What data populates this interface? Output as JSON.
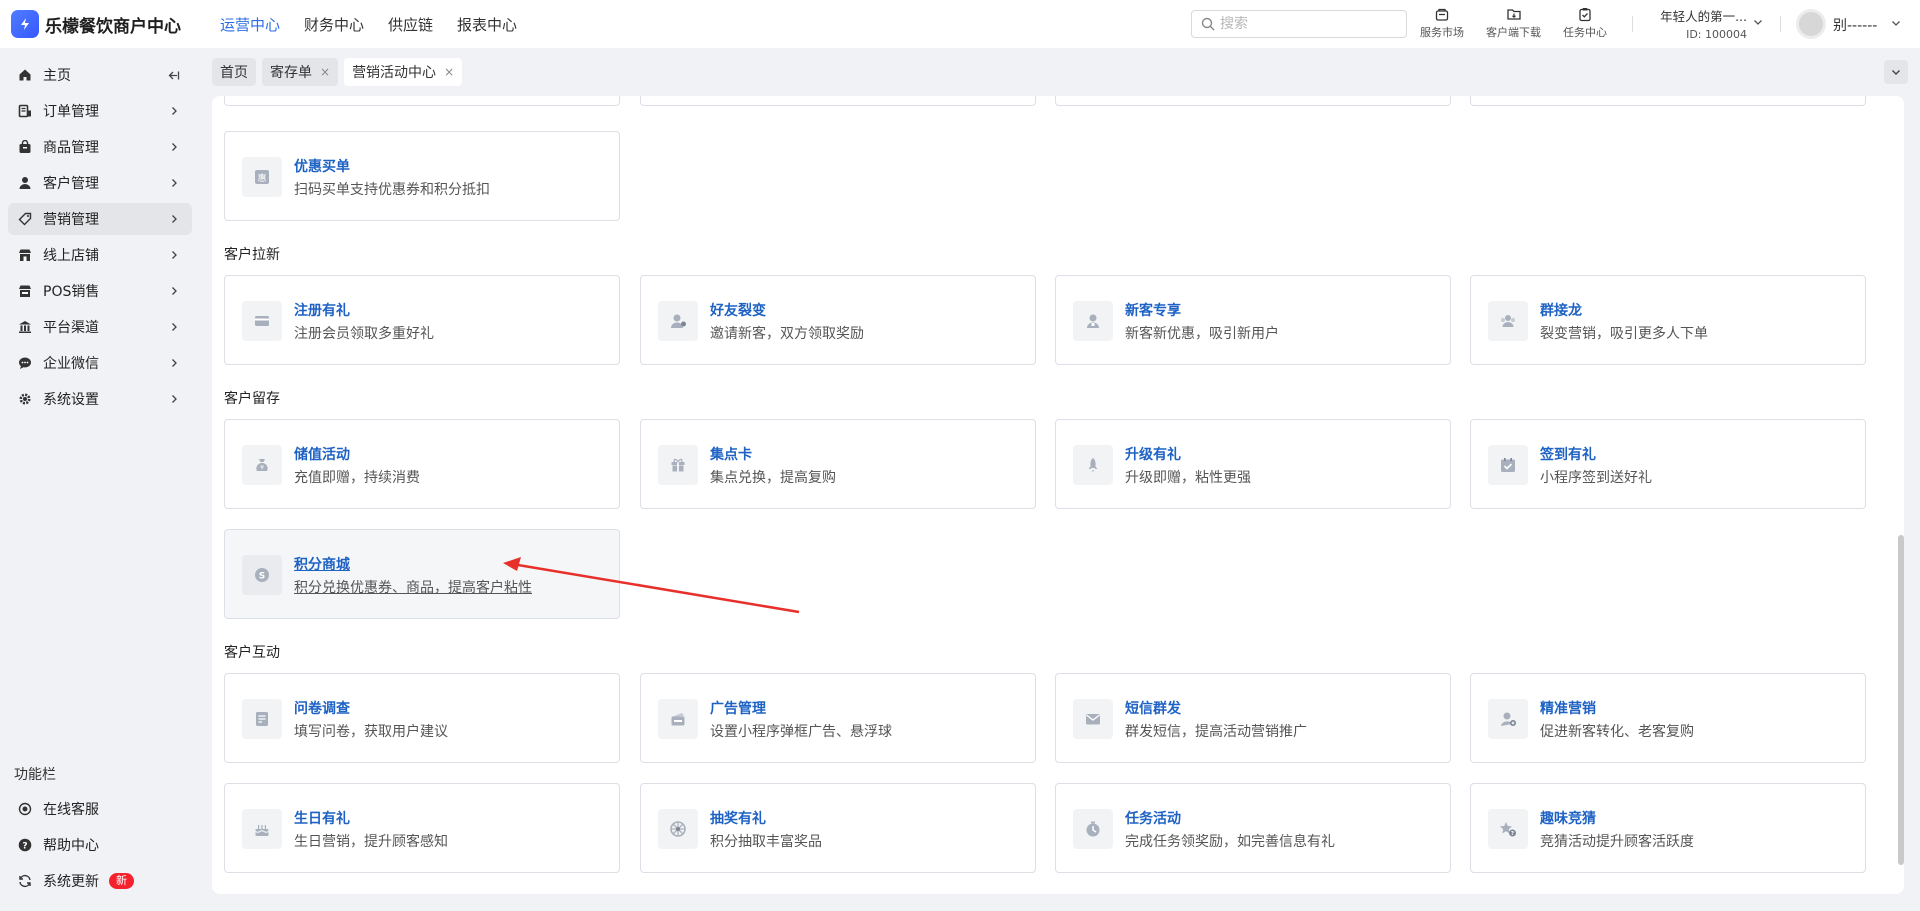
{
  "app": {
    "title": "乐檬餐饮商户中心"
  },
  "topnav": [
    "运营中心",
    "财务中心",
    "供应链",
    "报表中心"
  ],
  "search": {
    "placeholder": "搜索"
  },
  "tools": {
    "market": "服务市场",
    "download": "客户端下载",
    "tasks": "任务中心"
  },
  "account": {
    "name": "年轻人的第一...",
    "id": "ID: 100004",
    "user": "别------"
  },
  "sidebar": {
    "items": [
      {
        "label": "主页",
        "icon": "home-icon"
      },
      {
        "label": "订单管理",
        "icon": "order-icon"
      },
      {
        "label": "商品管理",
        "icon": "bag-icon"
      },
      {
        "label": "客户管理",
        "icon": "user-icon"
      },
      {
        "label": "营销管理",
        "icon": "tag-icon"
      },
      {
        "label": "线上店铺",
        "icon": "store-icon"
      },
      {
        "label": "POS销售",
        "icon": "pos-icon"
      },
      {
        "label": "平台渠道",
        "icon": "bank-icon"
      },
      {
        "label": "企业微信",
        "icon": "chat-icon"
      },
      {
        "label": "系统设置",
        "icon": "gear-icon"
      }
    ],
    "func_title": "功能栏",
    "bottom": [
      {
        "label": "在线客服",
        "icon": "support-icon"
      },
      {
        "label": "帮助中心",
        "icon": "help-icon"
      },
      {
        "label": "系统更新",
        "icon": "refresh-icon",
        "badge": "新"
      }
    ]
  },
  "tabs": [
    {
      "label": "首页"
    },
    {
      "label": "寄存单",
      "close": "×"
    },
    {
      "label": "营销活动中心",
      "close": "×"
    }
  ],
  "sections": {
    "lakhin": "客户拉新",
    "retain": "客户留存",
    "interact": "客户互动"
  },
  "cards": {
    "discount_pay": {
      "title": "优惠买单",
      "desc": "扫码买单支持优惠券和积分抵扣"
    },
    "register_gift": {
      "title": "注册有礼",
      "desc": "注册会员领取多重好礼"
    },
    "referral": {
      "title": "好友裂变",
      "desc": "邀请新客，双方领取奖励"
    },
    "new_customer": {
      "title": "新客专享",
      "desc": "新客新优惠，吸引新用户"
    },
    "group_chain": {
      "title": "群接龙",
      "desc": "裂变营销，吸引更多人下单"
    },
    "stored_value": {
      "title": "储值活动",
      "desc": "充值即赠，持续消费"
    },
    "stamp_card": {
      "title": "集点卡",
      "desc": "集点兑换，提高复购"
    },
    "upgrade_gift": {
      "title": "升级有礼",
      "desc": "升级即赠，粘性更强"
    },
    "checkin_gift": {
      "title": "签到有礼",
      "desc": "小程序签到送好礼"
    },
    "points_mall": {
      "title": "积分商城",
      "desc": "积分兑换优惠券、商品，提高客户粘性"
    },
    "survey": {
      "title": "问卷调查",
      "desc": "填写问卷，获取用户建议"
    },
    "ads": {
      "title": "广告管理",
      "desc": "设置小程序弹框广告、悬浮球"
    },
    "sms": {
      "title": "短信群发",
      "desc": "群发短信，提高活动营销推广"
    },
    "precision": {
      "title": "精准营销",
      "desc": "促进新客转化、老客复购"
    },
    "birthday": {
      "title": "生日有礼",
      "desc": "生日营销，提升顾客感知"
    },
    "lottery": {
      "title": "抽奖有礼",
      "desc": "积分抽取丰富奖品"
    },
    "task": {
      "title": "任务活动",
      "desc": "完成任务领奖励，如完善信息有礼"
    },
    "guess": {
      "title": "趣味竞猜",
      "desc": "竞猜活动提升顾客活跃度"
    }
  },
  "colors": {
    "accent": "#2b6de5",
    "card_title": "#1e62c4",
    "annotation_arrow": "#e8302a",
    "badge": "#f5222d"
  }
}
